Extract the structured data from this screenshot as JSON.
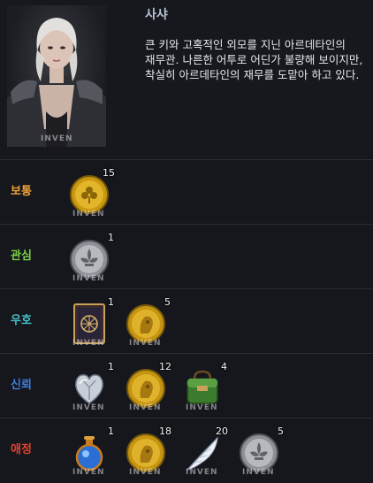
{
  "npc": {
    "name": "사샤",
    "description": "큰 키와 고혹적인 외모를 지닌 아르데타인의 재무관. 나른한 어투로 어딘가 불량해 보이지만, 착실히 아르데타인의 재무를 도맡아 하고 있다.",
    "watermark": "INVEN"
  },
  "rows": [
    {
      "level": "보통",
      "color": "#f0a033",
      "items": [
        {
          "icon": "gold-clover-coin",
          "count": "15"
        }
      ]
    },
    {
      "level": "관심",
      "color": "#7bd048",
      "items": [
        {
          "icon": "silver-fleur-coin",
          "count": "1"
        }
      ]
    },
    {
      "level": "우호",
      "color": "#46c2c8",
      "items": [
        {
          "icon": "tarot-card",
          "count": "1"
        },
        {
          "icon": "gold-face-coin",
          "count": "5"
        }
      ]
    },
    {
      "level": "신뢰",
      "color": "#3e7fe0",
      "items": [
        {
          "icon": "crystal-heart",
          "count": "1"
        },
        {
          "icon": "gold-face-coin",
          "count": "12"
        },
        {
          "icon": "green-backpack",
          "count": "4"
        }
      ]
    },
    {
      "level": "애정",
      "color": "#e2432f",
      "items": [
        {
          "icon": "blue-potion",
          "count": "1"
        },
        {
          "icon": "gold-face-coin",
          "count": "18"
        },
        {
          "icon": "white-feather",
          "count": "20"
        },
        {
          "icon": "silver-fleur-coin",
          "count": "5"
        }
      ]
    }
  ]
}
